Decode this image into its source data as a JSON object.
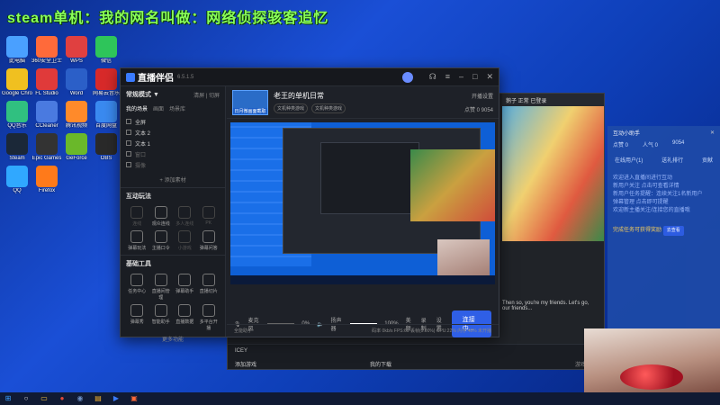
{
  "overlay": {
    "title": "steam单机：我的网名叫做：网络侦探骇客追忆"
  },
  "desktop_icons": [
    {
      "label": "此电脑",
      "color": "#4aa0ff"
    },
    {
      "label": "360安全卫士",
      "color": "#ff6a3a"
    },
    {
      "label": "WPS",
      "color": "#e04040"
    },
    {
      "label": "微信",
      "color": "#2ec55a"
    },
    {
      "label": "Google Chrome",
      "color": "#f0c020"
    },
    {
      "label": "FL Studio",
      "color": "#e03a3a"
    },
    {
      "label": "Word",
      "color": "#2b5fc8"
    },
    {
      "label": "网易云音乐",
      "color": "#d82a2a"
    },
    {
      "label": "QQ音乐",
      "color": "#30c080"
    },
    {
      "label": "CCleaner",
      "color": "#4a7ae0"
    },
    {
      "label": "腾讯视频",
      "color": "#ff8a2a"
    },
    {
      "label": "百度网盘",
      "color": "#3a8af0"
    },
    {
      "label": "Steam",
      "color": "#1b2838"
    },
    {
      "label": "Epic Games",
      "color": "#333"
    },
    {
      "label": "GeForce",
      "color": "#6ab82a"
    },
    {
      "label": "OBS",
      "color": "#2a2a2a"
    },
    {
      "label": "QQ",
      "color": "#30a8ff"
    },
    {
      "label": "Firefox",
      "color": "#ff7a1a"
    }
  ],
  "main_window": {
    "app_name": "直播伴侣",
    "version": "6.5.1.5",
    "scene_label": "常规模式 ▼",
    "scene_actions": "清屏 | 切屏",
    "tabs": [
      "我的场景",
      "画面",
      "场景库"
    ],
    "sources": [
      {
        "label": "全屏",
        "dim": false
      },
      {
        "label": "文本 2",
        "dim": false
      },
      {
        "label": "文本 1",
        "dim": false
      },
      {
        "label": "窗口",
        "dim": true
      },
      {
        "label": "摄像",
        "dim": true
      }
    ],
    "add_source": "+ 添加素材",
    "interact_title": "互动玩法",
    "interact_items": [
      {
        "label": "连线",
        "dim": true
      },
      {
        "label": "观众连线",
        "dim": false
      },
      {
        "label": "多人连线",
        "dim": true
      },
      {
        "label": "PK",
        "dim": true
      },
      {
        "label": "弹幕玩法",
        "dim": false
      },
      {
        "label": "主播口令",
        "dim": false
      },
      {
        "label": "小游戏",
        "dim": true
      },
      {
        "label": "弹幕问答",
        "dim": false
      }
    ],
    "tools_title": "基础工具",
    "tool_items": [
      {
        "label": "任务中心"
      },
      {
        "label": "直播间管理"
      },
      {
        "label": "弹幕助手"
      },
      {
        "label": "直播切片"
      },
      {
        "label": "弹幕秀"
      },
      {
        "label": "智能助手"
      },
      {
        "label": "直播数据"
      },
      {
        "label": "多平台开播"
      }
    ],
    "more": "更多功能",
    "room": {
      "thumb_label": "日月微画面截取",
      "title": "老王的单机日常",
      "tags": [
        "文机种类游戏",
        "文机种类游戏"
      ],
      "top_right": "开播设置",
      "counts": "点赞 0  9054"
    },
    "controls": {
      "mic": "麦克风",
      "mic_pct": "0%",
      "speaker": "扬声器",
      "speaker_pct": "100%",
      "beauty": "美颜",
      "record": "录制",
      "settings": "设置",
      "go_live": "连接中..."
    },
    "status": {
      "net": "全能助手",
      "stats": "码率 0kb/s  FPS:60  丢帧(0.00%)  CPU:22%  内存:48%  未开播"
    }
  },
  "back_window": {
    "user": "鹅子 正常 已登录",
    "dialog": "Then so, you're my friends. Let's go, our friends...",
    "game": "ICEY",
    "bottom_left": "添加游戏",
    "bottom_mid": "我的下载",
    "bottom_right": "游戏支付"
  },
  "right_panel": {
    "title": "互动小助手",
    "stats": [
      "点赞 0",
      "人气 0",
      "9054"
    ],
    "tabs": [
      "在线用户(1)",
      "送礼排行",
      "贡献"
    ],
    "lines": [
      "欢迎进入直播间进行互动",
      "新用户关注 点击可查看详情",
      "新用户任务提醒：连续关注1名新用户",
      "弹幕管理 点击即可提醒",
      "欢迎新主播关注/连接您的直播哦"
    ],
    "highlight": "完成任务可获得奖励",
    "button": "去查看"
  },
  "taskbar": {
    "items": [
      "start",
      "search",
      "explorer",
      "chrome",
      "steam",
      "folder",
      "live",
      "video"
    ]
  }
}
